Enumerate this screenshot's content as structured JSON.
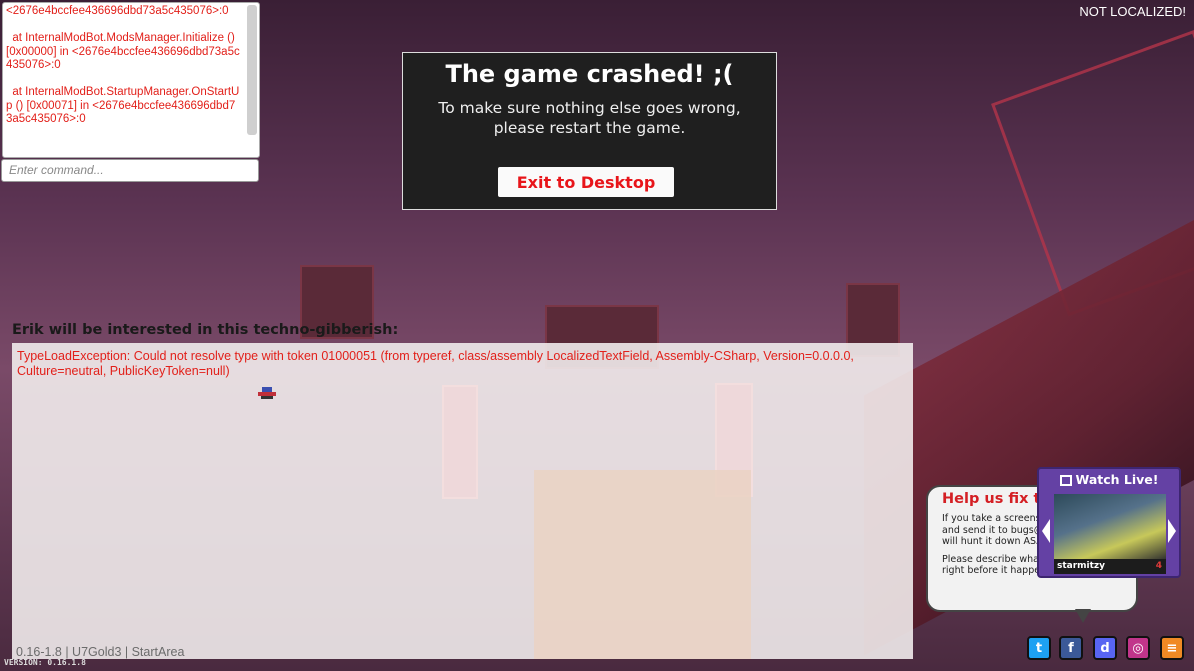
{
  "console": {
    "log_text": "<2676e4bccfee436696dbd73a5c435076>:0\n\n  at InternalModBot.ModsManager.Initialize () [0x00000] in <2676e4bccfee436696dbd73a5c435076>:0\n\n  at InternalModBot.StartupManager.OnStartUp () [0x00071] in <2676e4bccfee436696dbd73a5c435076>:0",
    "input_placeholder": "Enter command..."
  },
  "not_localized": "NOT LOCALIZED!",
  "crash_dialog": {
    "title": "The game crashed! ;(",
    "message": "To make sure nothing else goes wrong, please restart the game.",
    "exit_button": "Exit to Desktop"
  },
  "error_panel": {
    "label": "Erik will be interested in this techno-gibberish:",
    "error_text": "TypeLoadException: Could not resolve type with token 01000051 (from typeref, class/assembly LocalizedTextField, Assembly-CSharp, Version=0.0.0.0, Culture=neutral, PublicKeyToken=null)"
  },
  "footer": {
    "version_line": "0.16-1.8 | U7Gold3 | StartArea",
    "version_small": "VERSION: 0.16.1.8"
  },
  "help_bubble": {
    "title": "Help us fix th",
    "line1": "If you take a screensh",
    "line2": "and send it to bugs@",
    "line3": "will hunt it down ASA",
    "line4": "Please describe what",
    "line5": "right before it happened if you can"
  },
  "watch_live": {
    "title": "Watch Live!",
    "streamer": "starmitzy",
    "viewers": "4"
  },
  "social_icons": [
    {
      "name": "twitter-icon",
      "color": "#1da1f2",
      "glyph": "t"
    },
    {
      "name": "facebook-icon",
      "color": "#3b5998",
      "glyph": "f"
    },
    {
      "name": "discord-icon",
      "color": "#5865f2",
      "glyph": "d"
    },
    {
      "name": "instagram-icon",
      "color": "#c1358a",
      "glyph": "◎"
    },
    {
      "name": "blog-icon",
      "color": "#f08a24",
      "glyph": "≡"
    }
  ],
  "colors": {
    "error_red": "#e2201a",
    "twitch_purple": "#6441a4",
    "dialog_bg": "#1f1f1f"
  }
}
